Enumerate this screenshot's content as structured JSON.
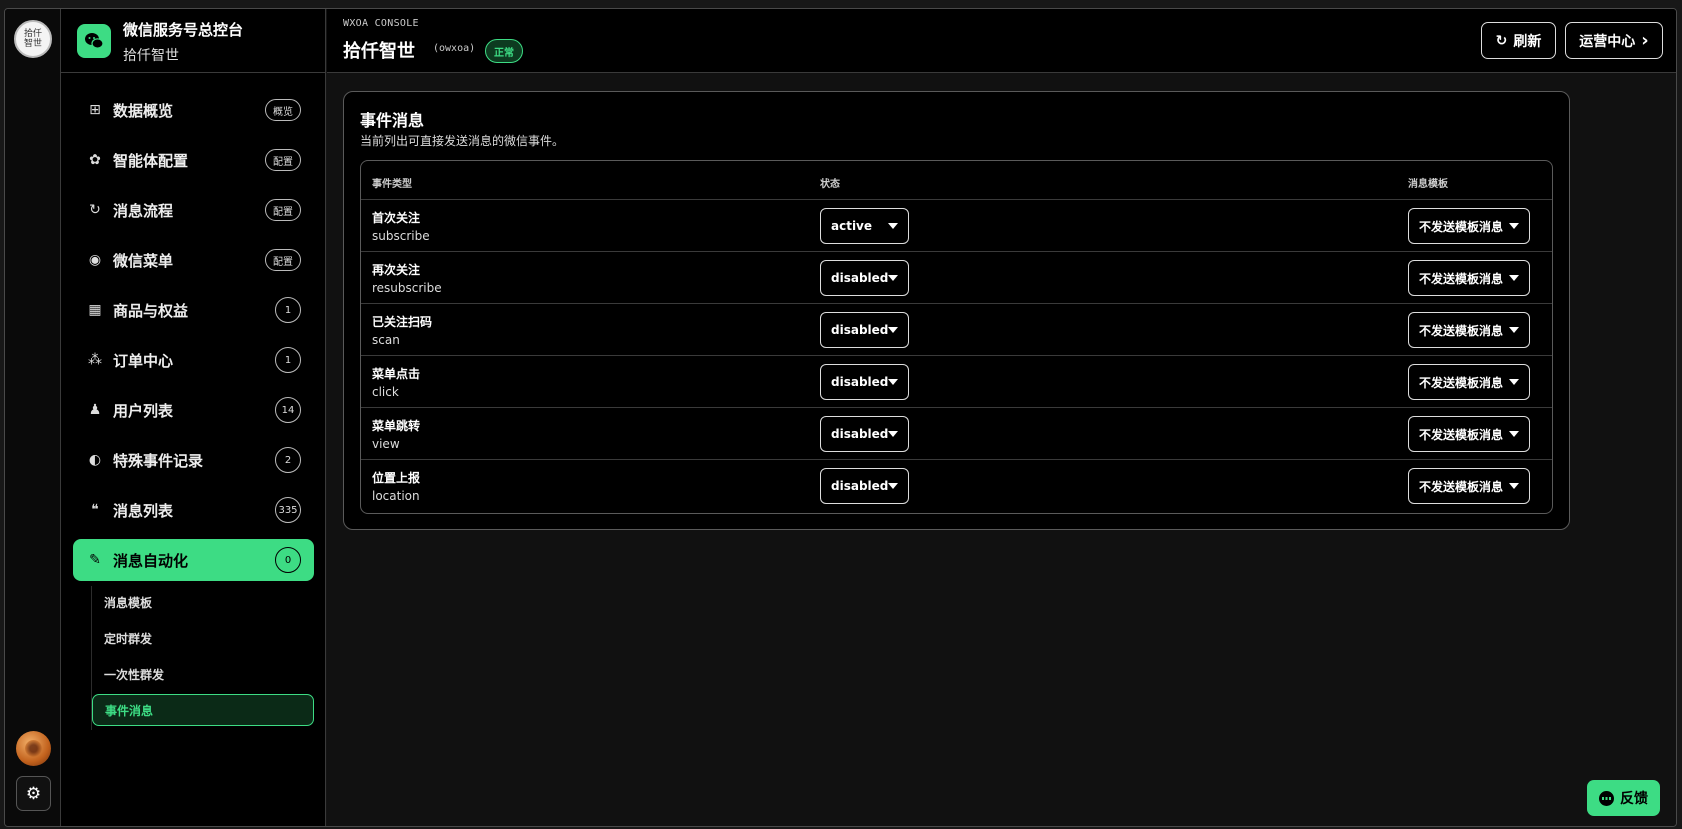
{
  "rail": {
    "logo_text": "拾仟\n智世",
    "settings_icon": "⚙"
  },
  "brand": {
    "title": "微信服务号总控台",
    "subtitle": "拾仟智世"
  },
  "nav": [
    {
      "icon": "⊞",
      "label": "数据概览",
      "badge": "概览",
      "round": false,
      "active": false
    },
    {
      "icon": "✿",
      "label": "智能体配置",
      "badge": "配置",
      "round": false,
      "active": false
    },
    {
      "icon": "↻",
      "label": "消息流程",
      "badge": "配置",
      "round": false,
      "active": false
    },
    {
      "icon": "◉",
      "label": "微信菜单",
      "badge": "配置",
      "round": false,
      "active": false
    },
    {
      "icon": "▦",
      "label": "商品与权益",
      "badge": "1",
      "round": true,
      "active": false
    },
    {
      "icon": "⁂",
      "label": "订单中心",
      "badge": "1",
      "round": true,
      "active": false
    },
    {
      "icon": "♟",
      "label": "用户列表",
      "badge": "14",
      "round": true,
      "active": false
    },
    {
      "icon": "◐",
      "label": "特殊事件记录",
      "badge": "2",
      "round": true,
      "active": false
    },
    {
      "icon": "❝",
      "label": "消息列表",
      "badge": "335",
      "round": true,
      "active": false
    },
    {
      "icon": "✎",
      "label": "消息自动化",
      "badge": "0",
      "round": true,
      "active": true
    }
  ],
  "subnav": [
    {
      "label": "消息模板",
      "active": false
    },
    {
      "label": "定时群发",
      "active": false
    },
    {
      "label": "一次性群发",
      "active": false
    },
    {
      "label": "事件消息",
      "active": true
    }
  ],
  "header": {
    "eyebrow": "WXOA CONSOLE",
    "title": "拾仟智世",
    "code": "(owxoa)",
    "status": "正常",
    "refresh_icon": "↻",
    "refresh_label": "刷新",
    "ops_label": "运营中心",
    "ops_icon": "›"
  },
  "card": {
    "title": "事件消息",
    "description": "当前列出可直接发送消息的微信事件。",
    "columns": [
      "事件类型",
      "状态",
      "消息模板"
    ],
    "rows": [
      {
        "name": "首次关注",
        "code": "subscribe",
        "status": "active",
        "template": "不发送模板消息"
      },
      {
        "name": "再次关注",
        "code": "resubscribe",
        "status": "disabled",
        "template": "不发送模板消息"
      },
      {
        "name": "已关注扫码",
        "code": "scan",
        "status": "disabled",
        "template": "不发送模板消息"
      },
      {
        "name": "菜单点击",
        "code": "click",
        "status": "disabled",
        "template": "不发送模板消息"
      },
      {
        "name": "菜单跳转",
        "code": "view",
        "status": "disabled",
        "template": "不发送模板消息"
      },
      {
        "name": "位置上报",
        "code": "location",
        "status": "disabled",
        "template": "不发送模板消息"
      }
    ]
  },
  "feedback": {
    "label": "反馈"
  }
}
